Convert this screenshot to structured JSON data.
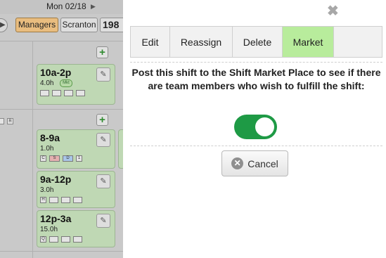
{
  "background": {
    "date_label": "Mon 02/18",
    "date_next_icon": "triangle-right-icon",
    "nav_icon": "triangle-right-icon",
    "buttons": {
      "managers": "Managers",
      "scranton": "Scranton",
      "count": "198"
    },
    "row_tag": "R",
    "plus_icon": "plus-icon",
    "pencil_icon": "pencil-icon",
    "cards": [
      {
        "time": "10a-2p",
        "hours": "4.0h",
        "badge": "Mkt",
        "tags": [
          "—",
          "—",
          "—",
          "—"
        ]
      },
      {
        "time": "8-9a",
        "hours": "1.0h",
        "tags": [
          "C",
          "S",
          "D",
          "1"
        ]
      },
      {
        "time": "9a-12p",
        "hours": "3.0h",
        "tags": [
          "H",
          "—",
          "—",
          "—"
        ]
      },
      {
        "time": "12p-3a",
        "hours": "15.0h",
        "tags": [
          "Q",
          "—",
          "—",
          "—"
        ]
      }
    ]
  },
  "modal": {
    "close_icon": "close-icon",
    "tabs": [
      {
        "label": "Edit",
        "active": false
      },
      {
        "label": "Reassign",
        "active": false
      },
      {
        "label": "Delete",
        "active": false
      },
      {
        "label": "Market",
        "active": true
      }
    ],
    "message": "Post this shift to the Shift Market Place to see if there are team members who wish to fulfill the shift:",
    "toggle_on": true,
    "toggle_color": "#1e9a45",
    "active_tab_color": "#b8ec9c",
    "cancel_icon": "cancel-circle-icon",
    "cancel_label": "Cancel"
  }
}
